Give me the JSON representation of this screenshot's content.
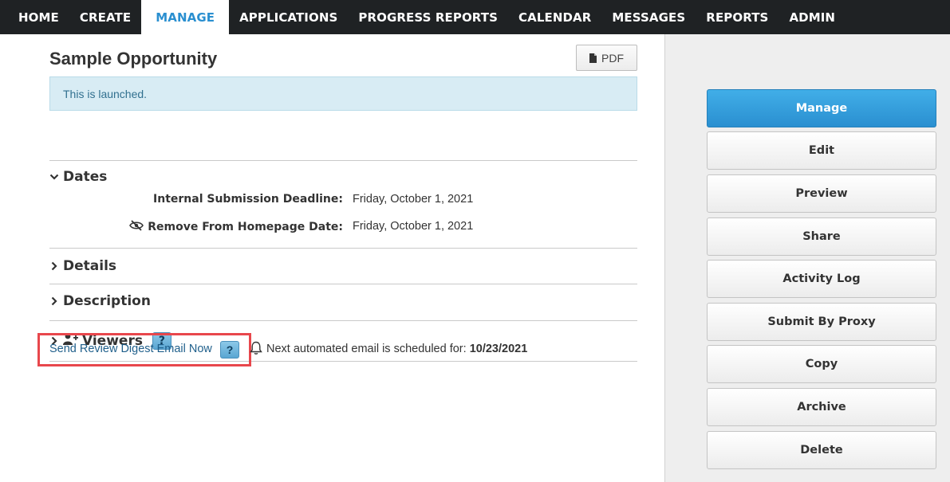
{
  "nav": {
    "items": [
      {
        "label": "HOME"
      },
      {
        "label": "CREATE"
      },
      {
        "label": "MANAGE",
        "active": true
      },
      {
        "label": "APPLICATIONS"
      },
      {
        "label": "PROGRESS REPORTS"
      },
      {
        "label": "CALENDAR"
      },
      {
        "label": "MESSAGES"
      },
      {
        "label": "REPORTS"
      },
      {
        "label": "ADMIN"
      }
    ]
  },
  "page": {
    "title": "Sample Opportunity",
    "pdf_label": "PDF",
    "alert": "This is launched."
  },
  "sections": {
    "dates": {
      "title": "Dates",
      "fields": [
        {
          "label": "Internal Submission Deadline:",
          "value": "Friday, October 1, 2021"
        },
        {
          "label": "Remove From Homepage Date:",
          "value": "Friday, October 1, 2021",
          "icon": "eye-slash-icon"
        }
      ]
    },
    "details": {
      "title": "Details"
    },
    "description": {
      "title": "Description"
    },
    "viewers": {
      "title": "Viewers",
      "help": "?"
    }
  },
  "digest": {
    "link_label": "Send Review Digest Email Now",
    "help": "?",
    "next_text": "Next automated email is scheduled for:",
    "next_date": "10/23/2021"
  },
  "sidebar": {
    "buttons": [
      {
        "label": "Manage",
        "primary": true
      },
      {
        "label": "Edit"
      },
      {
        "label": "Preview"
      },
      {
        "label": "Share"
      },
      {
        "label": "Activity Log"
      },
      {
        "label": "Submit By Proxy"
      },
      {
        "label": "Copy"
      },
      {
        "label": "Archive"
      },
      {
        "label": "Delete"
      }
    ]
  },
  "colors": {
    "nav_bg": "#1f2224",
    "nav_active": "#2a8fd0",
    "primary_button": "#2a8fd0",
    "alert_bg": "#d8ecf4",
    "highlight_box": "#e8474c",
    "link": "#1f5f8b"
  }
}
